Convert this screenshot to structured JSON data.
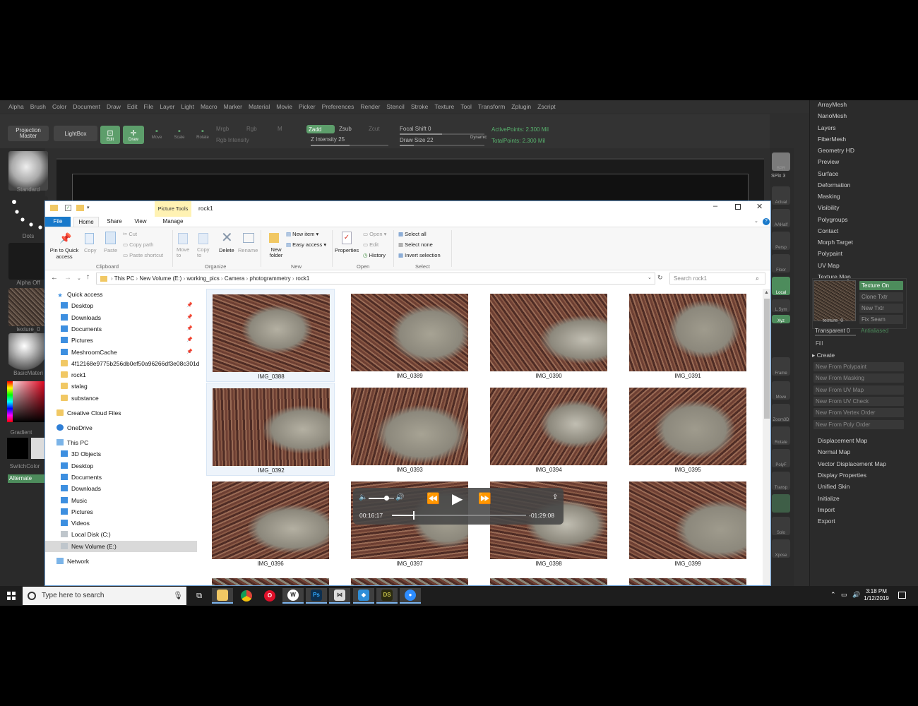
{
  "zbrush": {
    "menu": [
      "Alpha",
      "Brush",
      "Color",
      "Document",
      "Draw",
      "Edit",
      "File",
      "Layer",
      "Light",
      "Macro",
      "Marker",
      "Material",
      "Movie",
      "Picker",
      "Preferences",
      "Render",
      "Stencil",
      "Stroke",
      "Texture",
      "Tool",
      "Transform",
      "Zplugin",
      "Zscript"
    ],
    "toolbar": {
      "projection_master": "Projection Master",
      "lightbox": "LightBox",
      "edit": "Edit",
      "draw": "Draw",
      "move": "Move",
      "scale": "Scale",
      "rotate": "Rotate",
      "mrgb": "Mrgb",
      "rgb": "Rgb",
      "m": "M",
      "rgb_intensity": "Rgb Intensity",
      "zadd": "Zadd",
      "zsub": "Zsub",
      "zcut": "Zcut",
      "z_intensity": "Z Intensity 25",
      "focal_shift": "Focal Shift 0",
      "draw_size": "Draw Size 22",
      "dynamic": "Dynamic",
      "active_points": "ActivePoints: 2.300 Mil",
      "total_points": "TotalPoints: 2.300 Mil"
    },
    "left": {
      "standard": "Standard",
      "dots": "Dots",
      "alpha_off": "Alpha Off",
      "texture_0": "texture_0",
      "basic_material": "BasicMateri",
      "gradient": "Gradient",
      "switch_color": "SwitchColor",
      "alternate": "Alternate"
    },
    "shelf": {
      "bpr": "BPR",
      "spix": "SPix 3",
      "actual": "Actual",
      "aahalf": "AAHalf",
      "persp": "Persp",
      "floor": "Floor",
      "local": "Local",
      "lsym": "L.Sym",
      "xyz": "Xyz",
      "frame": "Frame",
      "move": "Move",
      "zoom3d": "Zoom3D",
      "rotate": "Rotate",
      "polyf": "PolyF",
      "transp": "Transp",
      "solo": "Solo",
      "xpose": "Xpose"
    },
    "palette_top": [
      "ArrayMesh",
      "NanoMesh",
      "Layers",
      "FiberMesh",
      "Geometry HD",
      "Preview",
      "Surface",
      "Deformation",
      "Masking",
      "Visibility",
      "Polygroups",
      "Contact",
      "Morph Target",
      "Polypaint",
      "UV Map",
      "Texture Map"
    ],
    "texture_map": {
      "texture_on": "Texture On",
      "clone_txtr": "Clone Txtr",
      "new_txtr": "New Txtr",
      "fix_seam": "Fix Seam",
      "thumb_label": "texture_0",
      "transparent": "Transparent 0",
      "antialiased": "Antialiased",
      "fill": "Fill",
      "create": "Create",
      "create_items": [
        "New From Polypaint",
        "New From Masking",
        "New From UV Map",
        "New From UV Check",
        "New From Vertex Order",
        "New From Poly Order"
      ]
    },
    "palette_bottom": [
      "Displacement Map",
      "Normal Map",
      "Vector Displacement Map",
      "Display Properties",
      "Unified Skin",
      "Initialize",
      "Import",
      "Export"
    ]
  },
  "explorer": {
    "title": "rock1",
    "picture_tools": "Picture Tools",
    "tabs": [
      "File",
      "Home",
      "Share",
      "View",
      "Manage"
    ],
    "ribbon": {
      "pin": "Pin to Quick access",
      "copy": "Copy",
      "paste": "Paste",
      "cut": "Cut",
      "copy_path": "Copy path",
      "paste_shortcut": "Paste shortcut",
      "clipboard": "Clipboard",
      "move_to": "Move to",
      "copy_to": "Copy to",
      "delete": "Delete",
      "rename": "Rename",
      "organize": "Organize",
      "new_folder": "New folder",
      "new_item": "New item",
      "easy_access": "Easy access",
      "new": "New",
      "properties": "Properties",
      "open": "Open",
      "edit": "Edit",
      "history": "History",
      "open_group": "Open",
      "select_all": "Select all",
      "select_none": "Select none",
      "invert_selection": "Invert selection",
      "select": "Select"
    },
    "breadcrumb": [
      "This PC",
      "New Volume (E:)",
      "working_pics",
      "Camera",
      "photogrammetry",
      "rock1"
    ],
    "search_placeholder": "Search rock1",
    "nav": {
      "quick_access": "Quick access",
      "quick_items": [
        {
          "label": "Desktop",
          "pinned": true
        },
        {
          "label": "Downloads",
          "pinned": true
        },
        {
          "label": "Documents",
          "pinned": true
        },
        {
          "label": "Pictures",
          "pinned": true
        },
        {
          "label": "MeshroomCache",
          "pinned": true
        },
        {
          "label": "4f12168e9775b256db0ef50a96266df3e08c301d",
          "pinned": false
        },
        {
          "label": "rock1",
          "pinned": false
        },
        {
          "label": "stalag",
          "pinned": false
        },
        {
          "label": "substance",
          "pinned": false
        }
      ],
      "creative_cloud": "Creative Cloud Files",
      "onedrive": "OneDrive",
      "this_pc": "This PC",
      "pc_items": [
        "3D Objects",
        "Desktop",
        "Documents",
        "Downloads",
        "Music",
        "Pictures",
        "Videos",
        "Local Disk (C:)",
        "New Volume (E:)"
      ],
      "network": "Network"
    },
    "files": [
      "IMG_0388",
      "IMG_0389",
      "IMG_0390",
      "IMG_0391",
      "IMG_0392",
      "IMG_0393",
      "IMG_0394",
      "IMG_0395",
      "IMG_0396",
      "IMG_0397",
      "IMG_0398",
      "IMG_0399"
    ]
  },
  "media": {
    "elapsed": "00:16:17",
    "remaining": "-01:29:08",
    "volume_level": 0.7,
    "progress": 0.16
  },
  "taskbar": {
    "search_placeholder": "Type here to search",
    "time": "3:18 PM",
    "date": "1/12/2019"
  },
  "colors": {
    "zb_green": "#5d9e6b",
    "explorer_blue": "#1979ca",
    "picture_tools_bg": "#fff2b3"
  }
}
